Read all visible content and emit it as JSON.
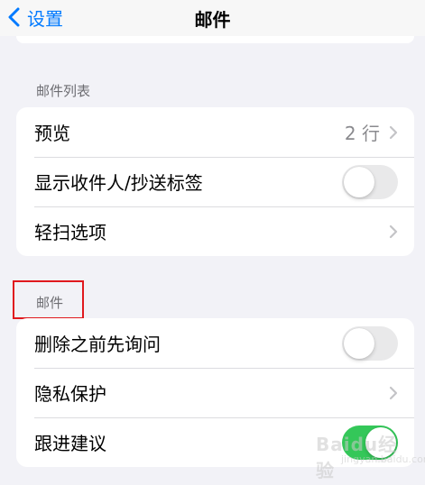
{
  "nav": {
    "back_label": "设置",
    "title": "邮件"
  },
  "sections": [
    {
      "header": "邮件列表",
      "rows": [
        {
          "label": "预览",
          "value": "2 行",
          "type": "chevron"
        },
        {
          "label": "显示收件人/抄送标签",
          "type": "toggle",
          "on": false
        },
        {
          "label": "轻扫选项",
          "type": "chevron"
        }
      ]
    },
    {
      "header": "邮件",
      "rows": [
        {
          "label": "删除之前先询问",
          "type": "toggle",
          "on": false
        },
        {
          "label": "隐私保护",
          "type": "chevron"
        },
        {
          "label": "跟进建议",
          "type": "toggle",
          "on": true
        }
      ]
    }
  ],
  "annotation": {
    "color": "#e0191e"
  },
  "colors": {
    "accent": "#007aff",
    "toggle_on": "#34c759",
    "background": "#f2f2f7"
  },
  "watermark": {
    "text": "Baidu经验",
    "sub": "jingyan.baidu.com"
  }
}
